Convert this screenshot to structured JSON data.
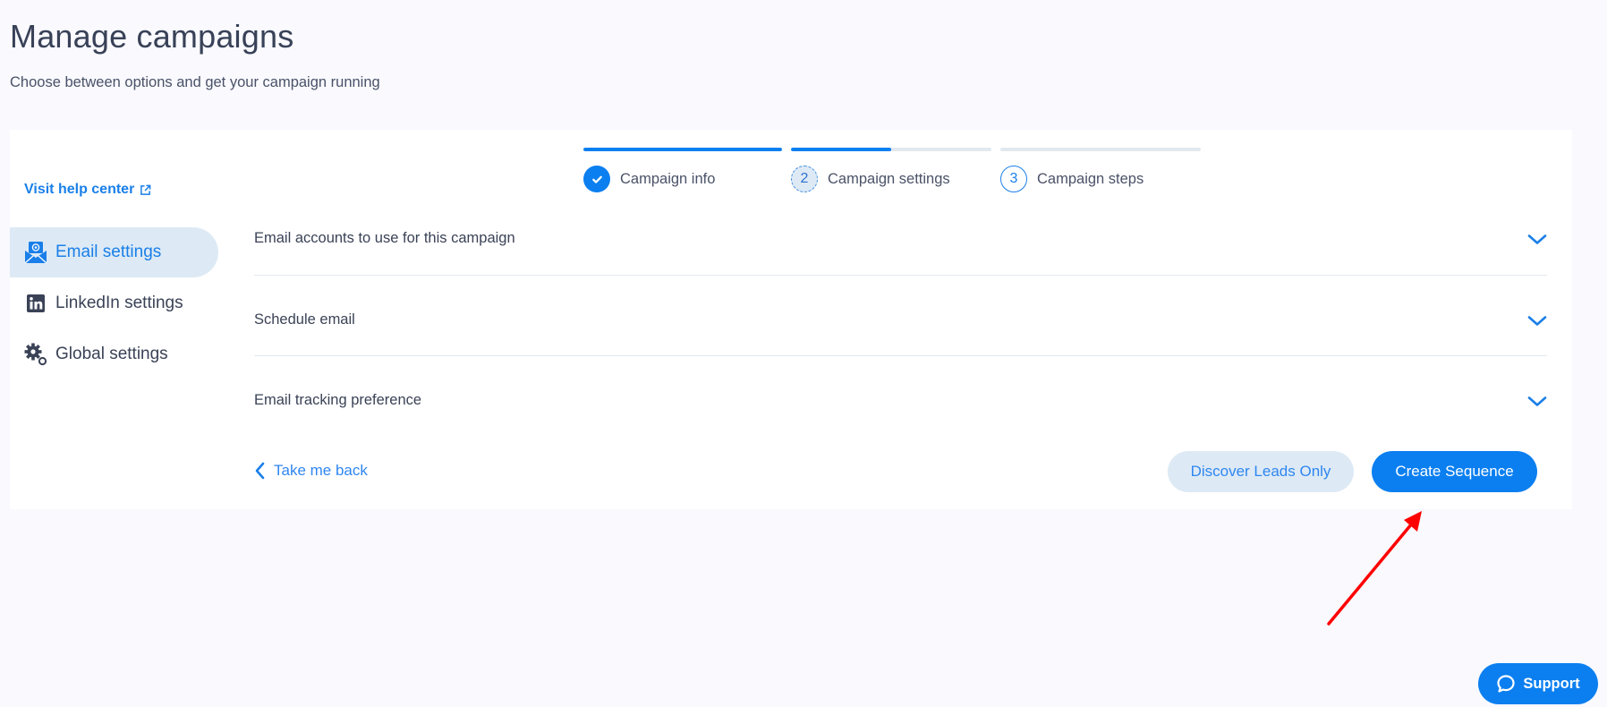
{
  "header": {
    "title": "Manage campaigns",
    "subtitle": "Choose between options and get your campaign running"
  },
  "sidebar": {
    "help_link": "Visit help center",
    "items": [
      {
        "label": "Email settings",
        "icon": "email-envelope-icon",
        "active": true
      },
      {
        "label": "LinkedIn settings",
        "icon": "linkedin-icon",
        "active": false
      },
      {
        "label": "Global settings",
        "icon": "gears-icon",
        "active": false
      }
    ]
  },
  "stepper": {
    "steps": [
      {
        "number": "1",
        "label": "Campaign info",
        "state": "completed",
        "progress": 1.0
      },
      {
        "number": "2",
        "label": "Campaign settings",
        "state": "current",
        "progress": 0.5
      },
      {
        "number": "3",
        "label": "Campaign steps",
        "state": "upcoming",
        "progress": 0.0
      }
    ]
  },
  "sections": [
    {
      "label": "Email accounts to use for this campaign",
      "expanded": false
    },
    {
      "label": "Schedule email",
      "expanded": false
    },
    {
      "label": "Email tracking preference",
      "expanded": false
    }
  ],
  "footer": {
    "back_label": "Take me back",
    "secondary_button": "Discover Leads Only",
    "primary_button": "Create Sequence"
  },
  "support": {
    "label": "Support"
  },
  "colors": {
    "accent": "#0b7ff0",
    "active_bg": "#ddeaf5",
    "annotation_arrow": "#ff0000"
  }
}
